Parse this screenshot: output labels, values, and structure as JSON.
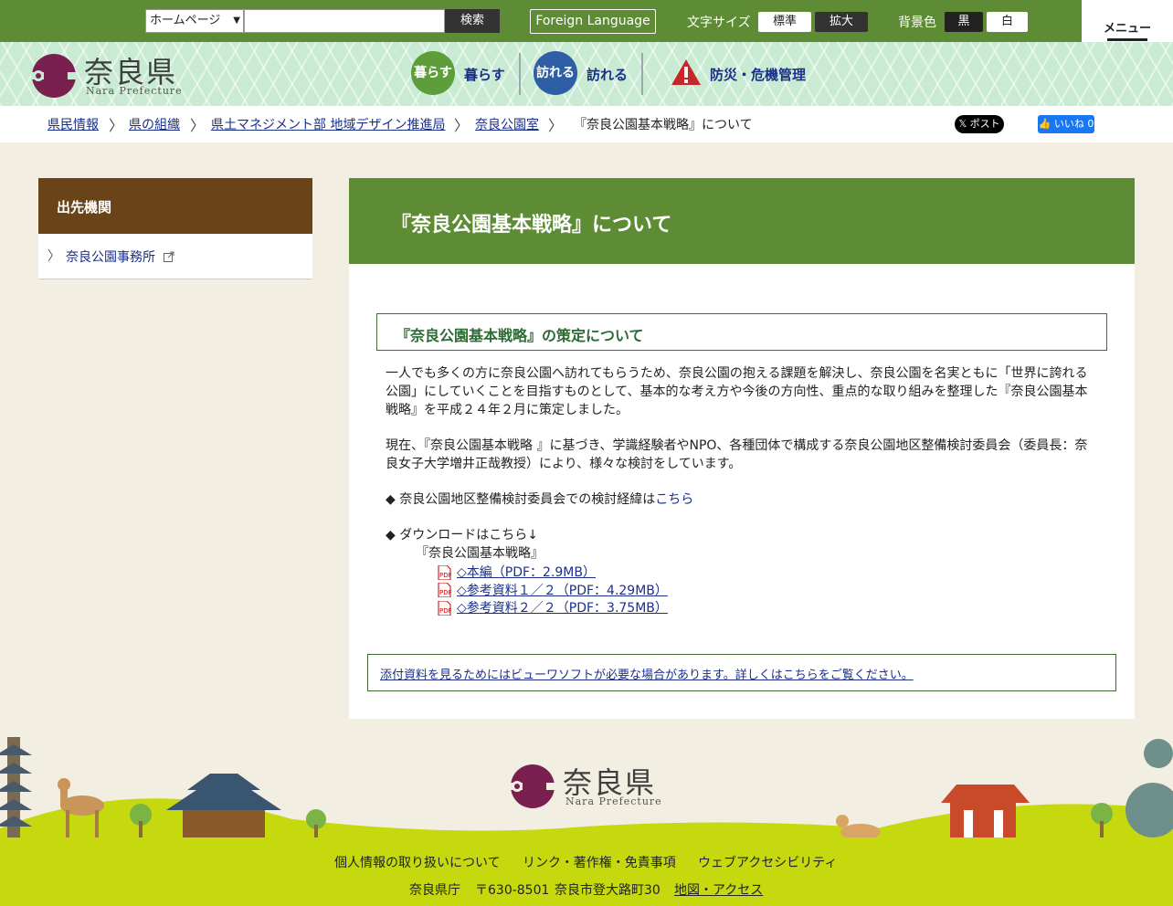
{
  "topbar": {
    "select_value": "ホームページ",
    "search_button": "検索",
    "foreign_language": "Foreign Language",
    "font_size_label": "文字サイズ",
    "font_standard": "標準",
    "font_large": "拡大",
    "bg_color_label": "背景色",
    "bg_black": "黒",
    "bg_white": "白",
    "menu_label": "メニュー"
  },
  "header": {
    "logo_text": "奈良県",
    "logo_sub": "Nara Prefecture",
    "nav": [
      {
        "icon_text": "暮らす",
        "label": "暮らす",
        "color": "#5d9e3a"
      },
      {
        "icon_text": "訪れる",
        "label": "訪れる",
        "color": "#2e5fa6"
      },
      {
        "icon_text": "!",
        "label": "防災・危機管理",
        "color": "#c62828"
      }
    ]
  },
  "breadcrumb": {
    "items": [
      "県民情報",
      "県の組織",
      "県土マネジメント部 地域デザイン推進局",
      "奈良公園室"
    ],
    "current": "『奈良公園基本戦略』について",
    "x_button": "ポスト",
    "fb_button": "いいね 0"
  },
  "sidebar": {
    "heading": "出先機関",
    "items": [
      {
        "label": "奈良公園事務所"
      }
    ]
  },
  "main": {
    "title": "『奈良公園基本戦略』について",
    "section_heading": "『奈良公園基本戦略』の策定について",
    "para1": "一人でも多くの方に奈良公園へ訪れてもらうため、奈良公園の抱える課題を解決し、奈良公園を名実ともに「世界に誇れる公園」にしていくことを目指すものとして、基本的な考え方や今後の方向性、重点的な取り組みを整理した『奈良公園基本戦略』を平成２４年２月に策定しました。",
    "para2": "現在、『奈良公園基本戦略 』に基づき、学識経験者やNPO、各種団体で構成する奈良公園地区整備検討委員会（委員長：奈良女子大学増井正哉教授）により、様々な検討をしています。",
    "history_prefix": "◆ 奈良公園地区整備検討委員会での検討経緯は",
    "history_link": "こちら",
    "download_heading": "◆ ダウンロードはこちら↓",
    "download_doc": "『奈良公園基本戦略』",
    "downloads": [
      {
        "label": "◇本編（PDF：2.9MB）"
      },
      {
        "label": "◇参考資料１／２（PDF：4.29MB）"
      },
      {
        "label": "◇参考資料２／２（PDF：3.75MB）"
      }
    ],
    "notice": "添付資料を見るためにはビューワソフトが必要な場合があります。詳しくはこちらをご覧ください。"
  },
  "footer": {
    "logo_text": "奈良県",
    "logo_sub": "Nara Prefecture",
    "links": [
      "個人情報の取り扱いについて",
      "リンク・著作権・免責事項",
      "ウェブアクセシビリティ"
    ],
    "office": "奈良県庁",
    "postal": "〒630-8501",
    "address": "奈良市登大路町30",
    "map_link": "地図・アクセス"
  },
  "colors": {
    "topbar": "#5d8c35",
    "accent_brown": "#6b4318",
    "logo_purple": "#7a2050",
    "footer_lime": "#c5d90e"
  }
}
